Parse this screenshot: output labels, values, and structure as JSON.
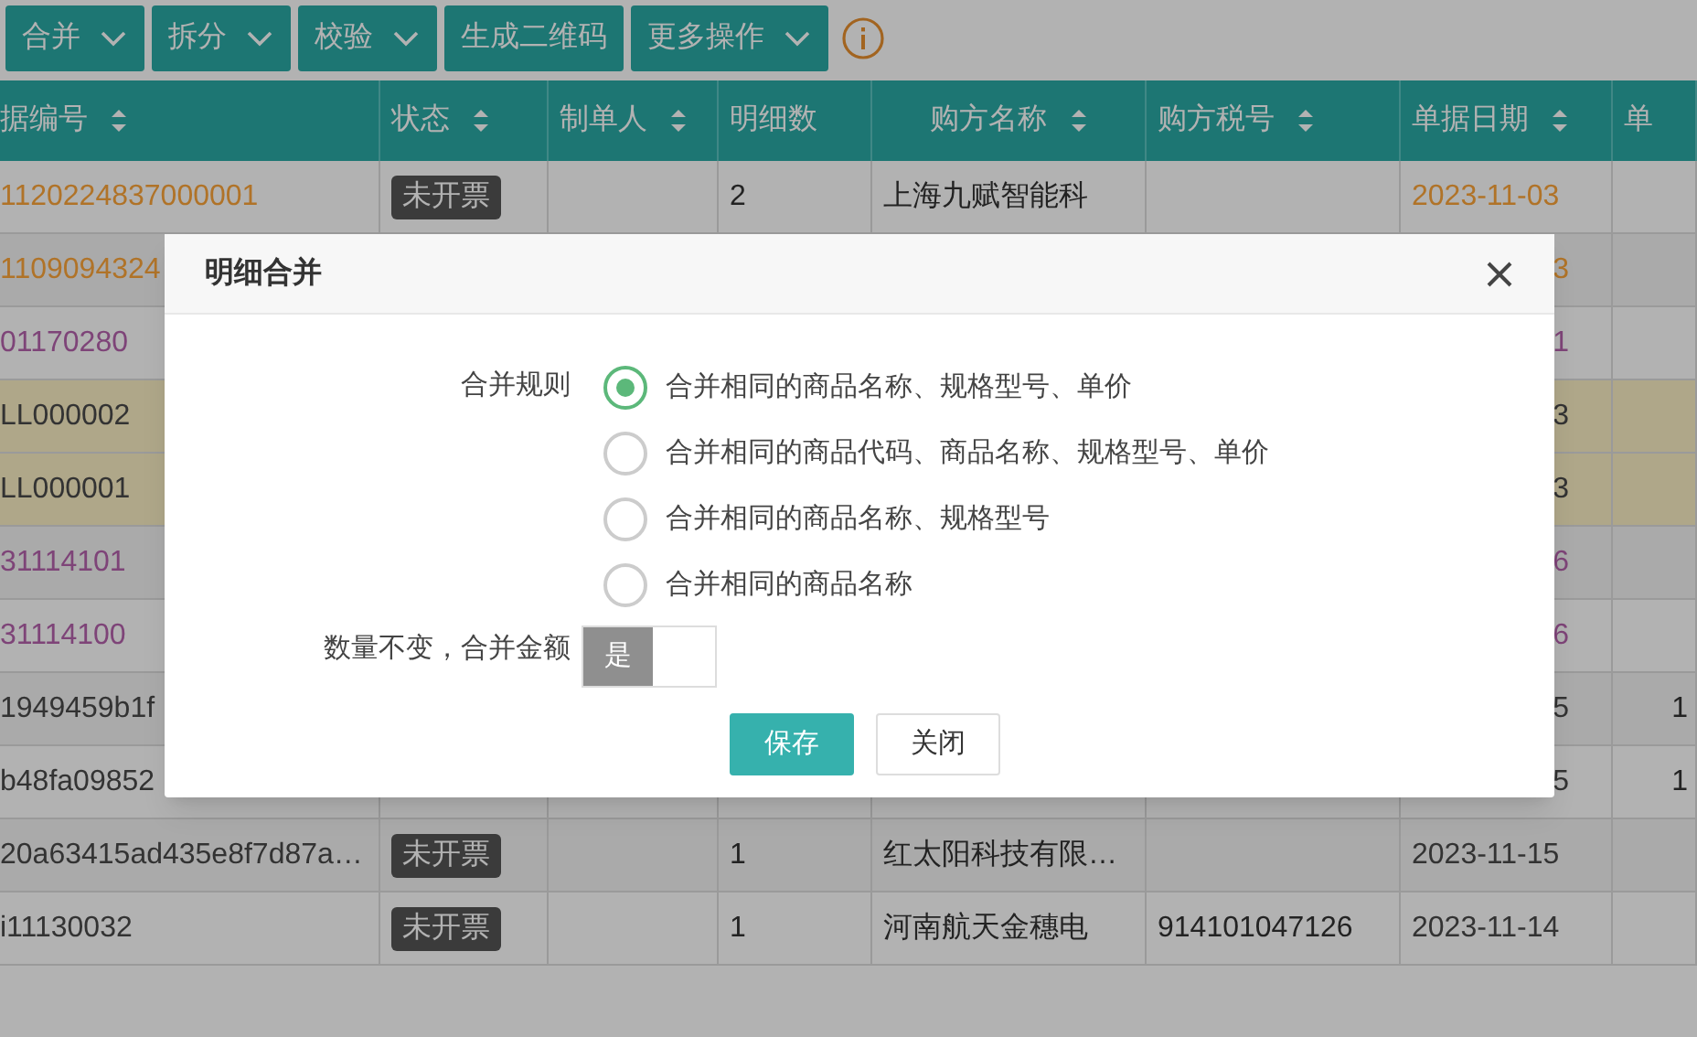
{
  "toolbar": {
    "buttons": [
      {
        "label": "合并",
        "kind": "dropdown"
      },
      {
        "label": "拆分",
        "kind": "dropdown"
      },
      {
        "label": "校验",
        "kind": "dropdown"
      },
      {
        "label": "生成二维码",
        "kind": "plain"
      },
      {
        "label": "更多操作",
        "kind": "dropdown"
      }
    ]
  },
  "table": {
    "columns": [
      {
        "label": "据编号",
        "sortable": true
      },
      {
        "label": "状态",
        "sortable": true
      },
      {
        "label": "制单人",
        "sortable": true
      },
      {
        "label": "明细数",
        "sortable": false
      },
      {
        "label": "购方名称",
        "sortable": true
      },
      {
        "label": "购方税号",
        "sortable": true
      },
      {
        "label": "单据日期",
        "sortable": true
      },
      {
        "label": "单",
        "sortable": false
      }
    ],
    "rows": [
      {
        "number": "1120224837000001",
        "status": "未开票",
        "count": "2",
        "buyer": "上海九赋智能科",
        "date": "2023-11-03",
        "color": "#b07328",
        "highlighted": false
      },
      {
        "number": "1109094324",
        "date": "3",
        "color": "#b07328",
        "highlighted": false
      },
      {
        "number": "01170280",
        "date": "1",
        "color": "#7e4478",
        "highlighted": false
      },
      {
        "number": "LL000002",
        "date": "3",
        "color": "#333333",
        "highlighted": true
      },
      {
        "number": "LL000001",
        "date": "3",
        "color": "#333333",
        "highlighted": true
      },
      {
        "number": "31114101",
        "date": "6",
        "color": "#7e4478",
        "highlighted": false
      },
      {
        "number": "31114100",
        "date": "6",
        "color": "#7e4478",
        "highlighted": false
      },
      {
        "number": "1949459b1f",
        "date": "5",
        "column_8": "1",
        "color": "#333333",
        "highlighted": false
      },
      {
        "number": "b48fa09852",
        "date": "5",
        "column_8": "1",
        "color": "#333333",
        "highlighted": false
      },
      {
        "number": "20a63415ad435e8f7d87a…",
        "status": "未开票",
        "count": "1",
        "buyer": "红太阳科技有限…",
        "date": "2023-11-15",
        "color": "#333333",
        "highlighted": false
      },
      {
        "number": "i11130032",
        "status": "未开票",
        "count": "1",
        "buyer": "河南航天金穗电",
        "tax_no": "914101047126",
        "date": "2023-11-14",
        "color": "#333333",
        "highlighted": false
      }
    ]
  },
  "dialog": {
    "title": "明细合并",
    "rule_label": "合并规则",
    "options": [
      {
        "label": "合并相同的商品名称、规格型号、单价",
        "selected": true
      },
      {
        "label": "合并相同的商品代码、商品名称、规格型号、单价",
        "selected": false
      },
      {
        "label": "合并相同的商品名称、规格型号",
        "selected": false
      },
      {
        "label": "合并相同的商品名称",
        "selected": false
      }
    ],
    "toggle_label": "数量不变，合并金额",
    "toggle": {
      "label": "是",
      "on": false
    },
    "buttons": [
      {
        "label": "保存",
        "kind": "primary"
      },
      {
        "label": "关闭",
        "kind": "default"
      }
    ]
  }
}
